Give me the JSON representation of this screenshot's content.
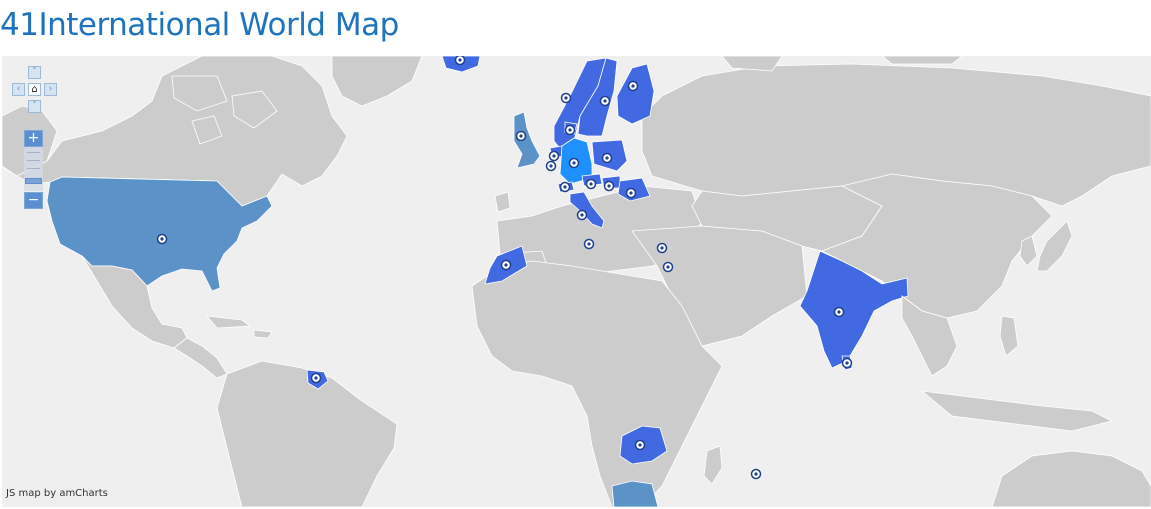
{
  "page": {
    "title": "41International World Map"
  },
  "map": {
    "credit": "JS map by amCharts",
    "colors": {
      "ocean": "#efefef",
      "land": "#cccccc",
      "highlight": "#4169e1",
      "alternate": "#5b93c9",
      "selected": "#1e90ff",
      "marker": "#1f3f8f"
    },
    "controls": {
      "pan_up_icon": "chevron-up-icon",
      "pan_left_icon": "chevron-left-icon",
      "pan_home_icon": "home-icon",
      "pan_right_icon": "chevron-right-icon",
      "pan_down_icon": "chevron-down-icon",
      "zoom_in_label": "+",
      "zoom_out_label": "−"
    }
  }
}
